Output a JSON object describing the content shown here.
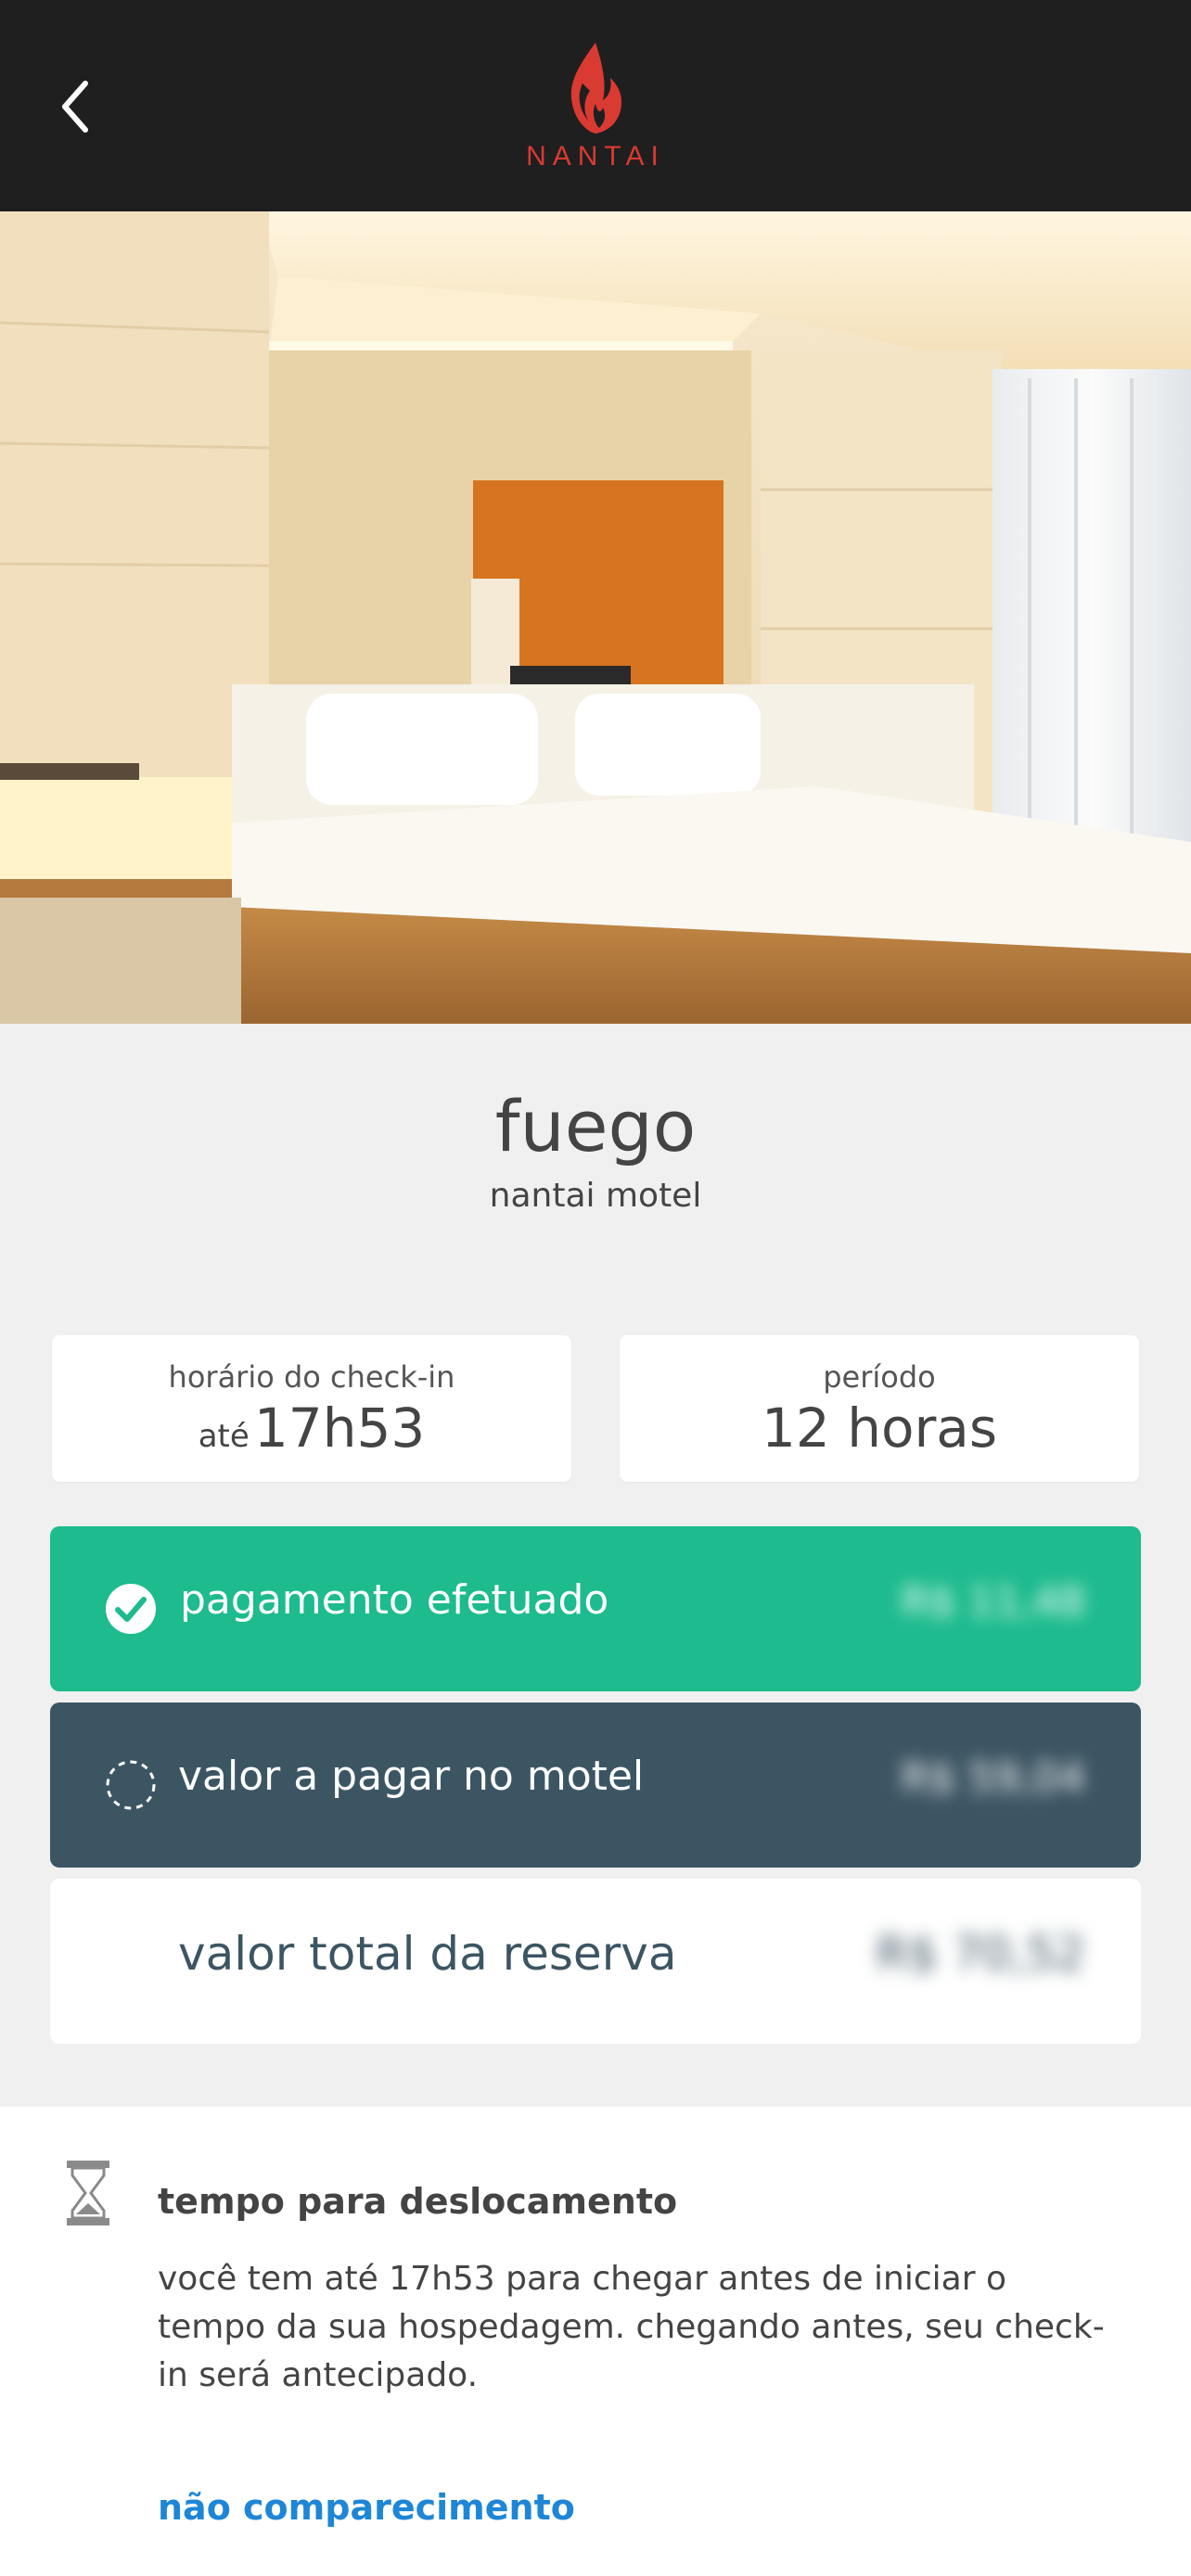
{
  "header": {
    "back_icon": "chevron-left-icon",
    "logo_icon": "flame-icon",
    "logo_text": "NANTAI",
    "brand_color": "#d93a32"
  },
  "hero": {
    "description_icon": "room-photo"
  },
  "room": {
    "name": "fuego",
    "motel": "nantai motel"
  },
  "checkin": {
    "label": "horário do check-in",
    "prefix": "até",
    "time": "17h53"
  },
  "period": {
    "label": "período",
    "value": "12 horas"
  },
  "payment": {
    "paid_label": "pagamento efetuado",
    "paid_value": "R$ 11,48",
    "paid_icon": "check-circle-icon",
    "due_label": "valor a pagar no motel",
    "due_value": "R$ 59,04",
    "due_icon": "dashed-circle-icon",
    "total_label": "valor total da reserva",
    "total_value": "R$ 70,52",
    "colors": {
      "paid": "#1dbb8e",
      "due": "#3c5563",
      "total_text": "#3c5563"
    }
  },
  "travel": {
    "icon": "hourglass-icon",
    "title": "tempo para deslocamento",
    "text": "você tem até 17h53 para chegar antes de iniciar o tempo da sua hospedagem. chegando antes, seu check-in será antecipado.",
    "link": "não comparecimento",
    "link_color": "#1e86d6"
  }
}
